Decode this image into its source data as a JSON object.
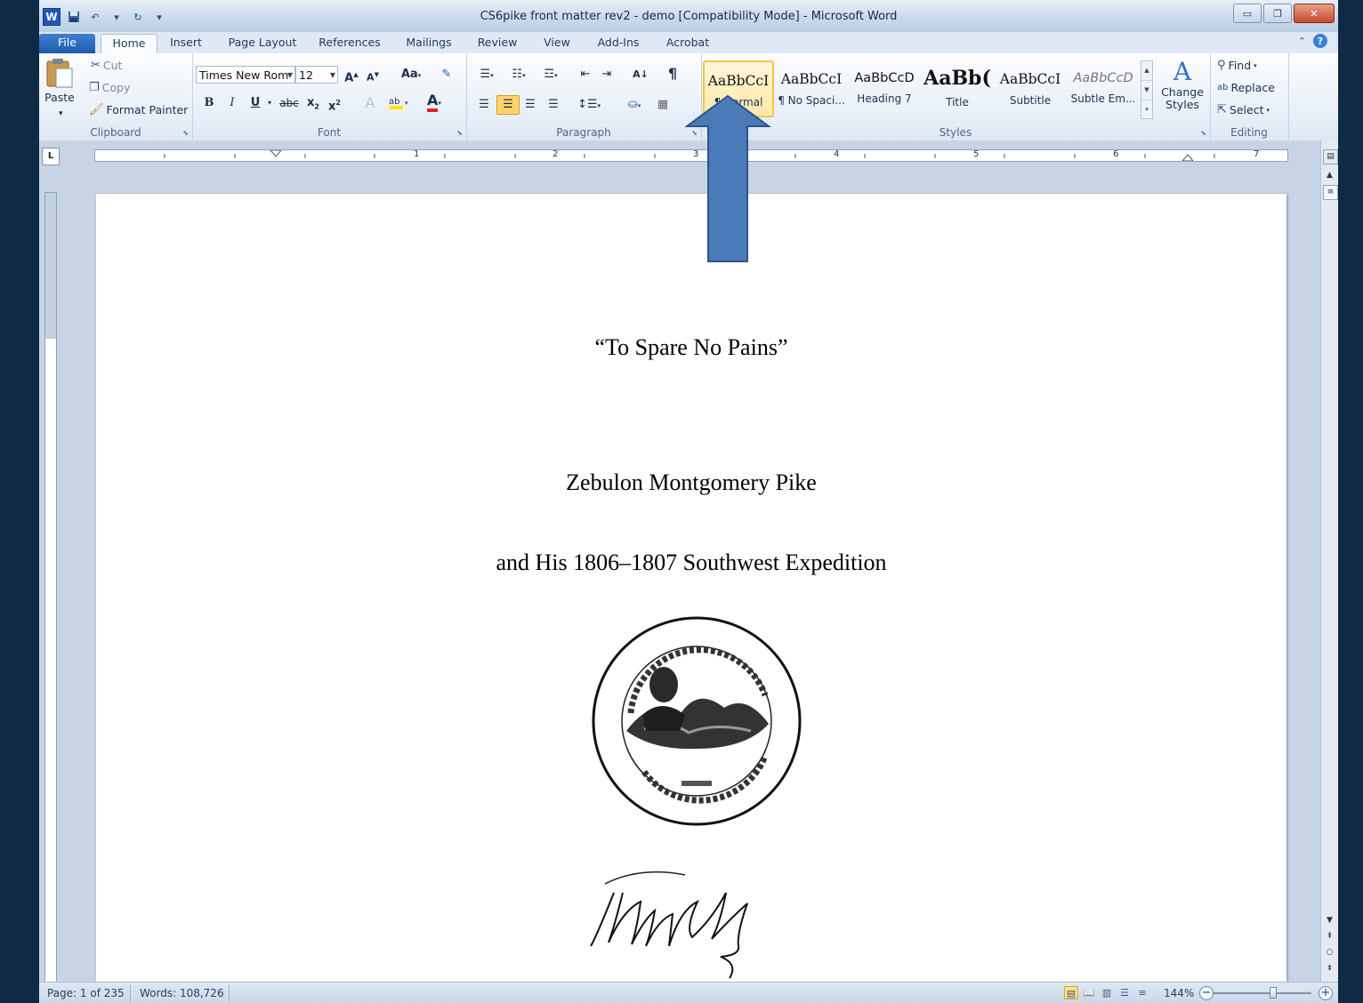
{
  "window": {
    "title": "CS6pike front matter rev2 - demo [Compatibility Mode] - Microsoft Word",
    "app_icon_label": "W",
    "controls": {
      "minimize": "▭",
      "restore": "❐",
      "close": "✕"
    }
  },
  "tabs": [
    "File",
    "Home",
    "Insert",
    "Page Layout",
    "References",
    "Mailings",
    "Review",
    "View",
    "Add-Ins",
    "Acrobat"
  ],
  "active_tab": "Home",
  "ribbon": {
    "clipboard": {
      "label": "Clipboard",
      "paste": "Paste",
      "cut": "Cut",
      "copy": "Copy",
      "format_painter": "Format Painter"
    },
    "font": {
      "label": "Font",
      "font_name": "Times New Rom",
      "font_size": "12",
      "grow": "A",
      "shrink": "A",
      "change_case": "Aa",
      "bold": "B",
      "italic": "I",
      "underline": "U",
      "strikethrough": "abc",
      "subscript": "x",
      "superscript": "x",
      "font_color": "A"
    },
    "paragraph": {
      "label": "Paragraph",
      "show_hide": "¶",
      "sort": "A↓"
    },
    "styles": {
      "label": "Styles",
      "items": [
        {
          "sample": "AaBbCcI",
          "name": "¶ Normal"
        },
        {
          "sample": "AaBbCcI",
          "name": "¶ No Spaci..."
        },
        {
          "sample": "AaBbCcD",
          "name": "Heading 7"
        },
        {
          "sample": "AaBb(",
          "name": "Title"
        },
        {
          "sample": "AaBbCcI",
          "name": "Subtitle"
        },
        {
          "sample": "AaBbCcD",
          "name": "Subtle Em..."
        }
      ],
      "change_styles": "Change Styles"
    },
    "editing": {
      "label": "Editing",
      "find": "Find",
      "replace": "Replace",
      "select": "Select"
    }
  },
  "ruler": {
    "numbers": [
      "1",
      "2",
      "3",
      "4",
      "5",
      "6",
      "7"
    ],
    "tab_selector": "L"
  },
  "document": {
    "line1": "“To Spare No Pains”",
    "line2": "Zebulon Montgomery Pike",
    "line3": "and His 1806–1807 Southwest Expedition"
  },
  "status": {
    "page": "Page: 1 of 235",
    "words": "Words: 108,726",
    "zoom": "144%",
    "zoom_level_percent": 144
  },
  "colors": {
    "accent": "#1f5bb0",
    "arrow_fill": "#4a7ab8",
    "arrow_stroke": "#2f548a",
    "selected_style": "#ffe9a8"
  }
}
